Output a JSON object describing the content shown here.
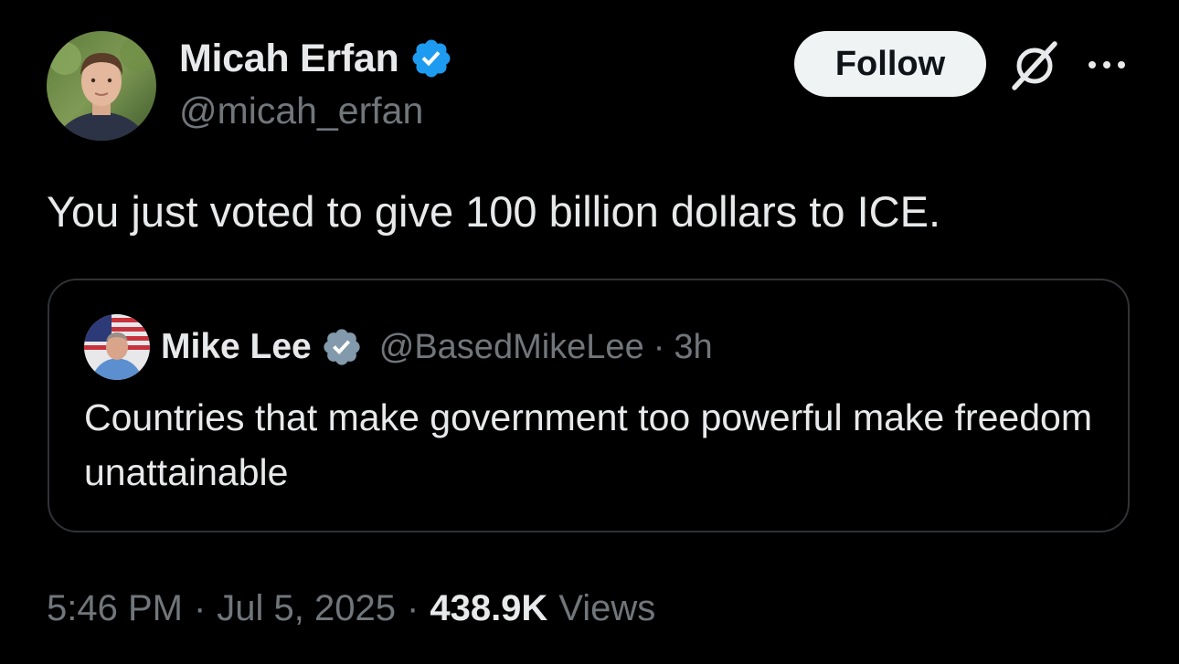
{
  "author": {
    "display_name": "Micah Erfan",
    "handle": "@micah_erfan",
    "verified": true
  },
  "follow_button": {
    "label": "Follow"
  },
  "icons": {
    "verified": "verified-badge-icon",
    "grok": "grok-icon",
    "more": "more-options-icon"
  },
  "tweet": {
    "text": "You just voted to give 100 billion dollars to ICE."
  },
  "quoted_tweet": {
    "display_name": "Mike Lee",
    "handle": "@BasedMikeLee",
    "separator": "·",
    "time": "3h",
    "text": "Countries that make government too powerful make freedom unattainable",
    "verified_type": "gray-government"
  },
  "meta": {
    "time": "5:46 PM",
    "separator": "·",
    "date": "Jul 5, 2025",
    "views_count": "438.9K",
    "views_label": "Views"
  },
  "colors": {
    "background": "#000000",
    "primary_text": "#e7e9ea",
    "secondary_text": "#71767b",
    "verified_blue": "#1d9bf0",
    "verified_gray": "#829aab",
    "border": "#2f3336",
    "follow_bg": "#eff3f4"
  }
}
